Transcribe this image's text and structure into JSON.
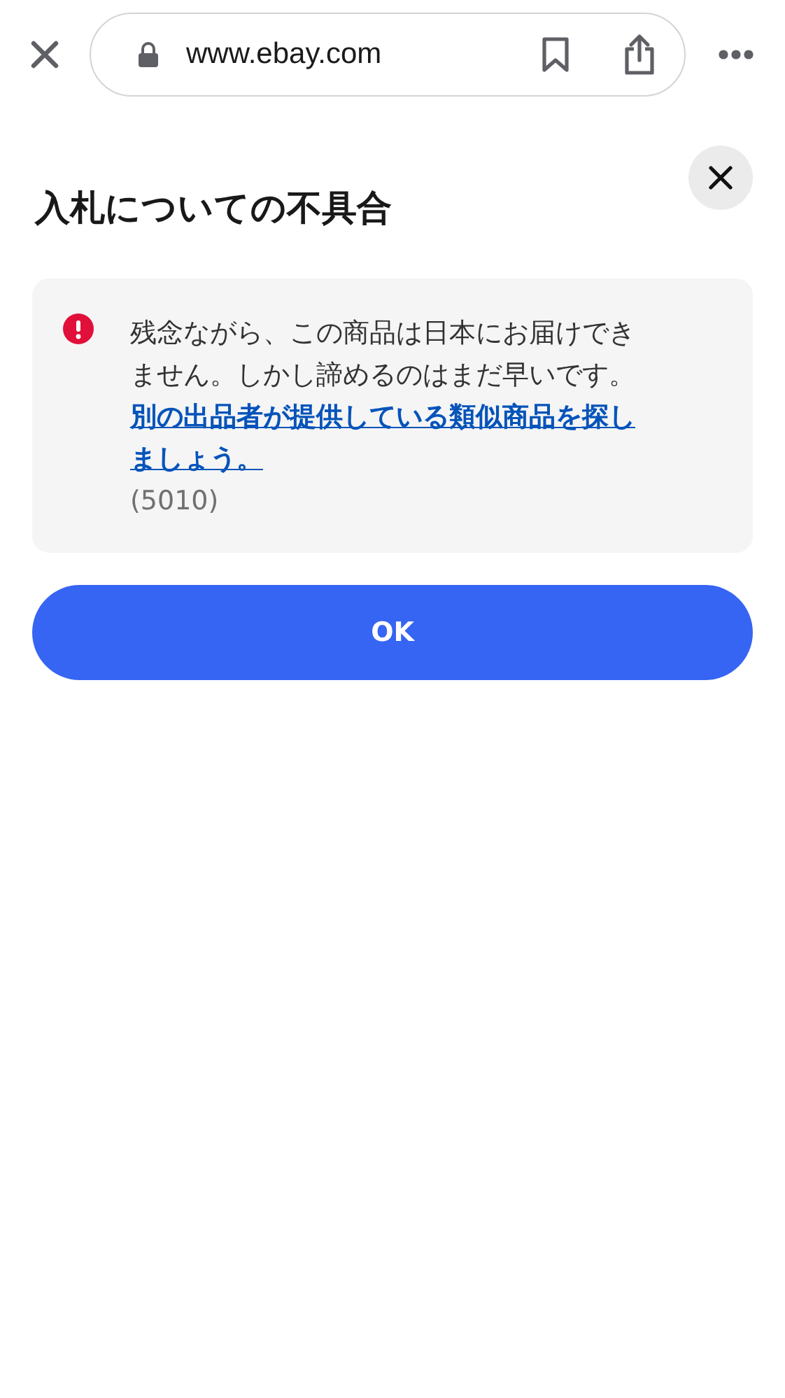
{
  "browser": {
    "url": "www.ebay.com"
  },
  "dialog": {
    "title": "入札についての不具合",
    "alert": {
      "message": "残念ながら、この商品は日本にお届けできません。しかし諦めるのはまだ早いです。",
      "link": "別の出品者が提供している類似商品を探しましょう。",
      "code": "(5010)"
    },
    "buttons": [
      "OK"
    ]
  }
}
